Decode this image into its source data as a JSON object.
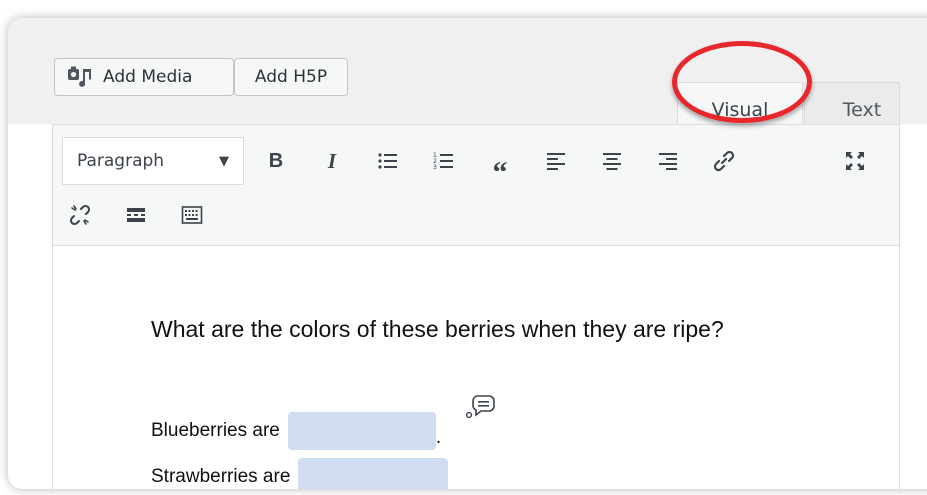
{
  "topbar": {
    "add_media_label": "Add Media",
    "add_h5p_label": "Add H5P"
  },
  "tabs": {
    "visual_label": "Visual",
    "text_label": "Text",
    "active": "Visual"
  },
  "highlight_color": "#e8262b",
  "toolbar": {
    "format_select_value": "Paragraph",
    "bold_glyph": "B",
    "italic_glyph": "I",
    "quote_glyph": "“",
    "icons_row1": [
      "bold-icon",
      "italic-icon",
      "bulleted-list-icon",
      "numbered-list-icon",
      "blockquote-icon",
      "align-left-icon",
      "align-center-icon",
      "align-right-icon",
      "link-icon",
      "fullscreen-icon"
    ],
    "icons_row2": [
      "unlink-icon",
      "read-more-icon",
      "toolbar-toggle-icon"
    ]
  },
  "content": {
    "question": "What are the colors of these berries when they are ripe?",
    "rows": [
      {
        "label": "Blueberries are",
        "suffix": "."
      },
      {
        "label": "Strawberries are",
        "suffix": ""
      }
    ],
    "blank_color": "#cfdcf2"
  }
}
